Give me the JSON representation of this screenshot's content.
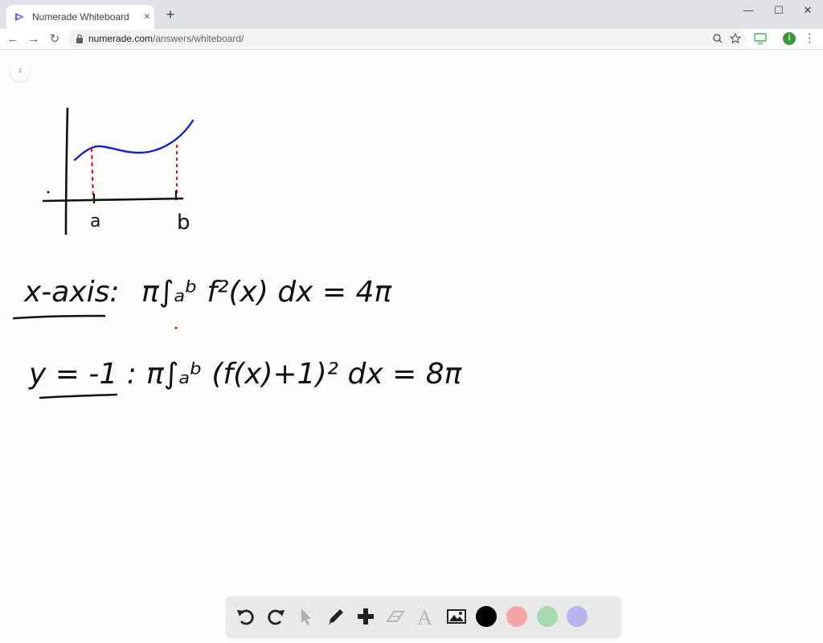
{
  "browser": {
    "tab_title": "Numerade Whiteboard",
    "tab_close": "×",
    "new_tab": "+",
    "url_host": "numerade.com",
    "url_path": "/answers/whiteboard/",
    "profile_initial": "i",
    "window_controls": {
      "minimize": "—",
      "maximize": "☐",
      "close": "✕"
    },
    "nav": {
      "back": "←",
      "forward": "→",
      "reload": "↻"
    }
  },
  "whiteboard": {
    "page_number": "1",
    "graph": {
      "label_a": "a",
      "label_b": "b",
      "curve_color": "#1c1ccf",
      "guide_color": "#d01a2a"
    },
    "equations": [
      {
        "label": "x-axis:",
        "expression": "π∫ₐᵇ f²(x) dx = 4π"
      },
      {
        "label": "y = -1 :",
        "expression": "π∫ₐᵇ (f(x)+1)² dx = 8π"
      }
    ]
  },
  "palette": {
    "tools": [
      "undo-icon",
      "redo-icon",
      "pointer-icon",
      "pencil-icon",
      "plus-icon",
      "eraser-icon",
      "text-icon",
      "image-icon"
    ],
    "text_tool_glyph": "A",
    "colors": [
      "#000000",
      "#f4a6a6",
      "#a9d8b0",
      "#b8b4ee"
    ]
  }
}
